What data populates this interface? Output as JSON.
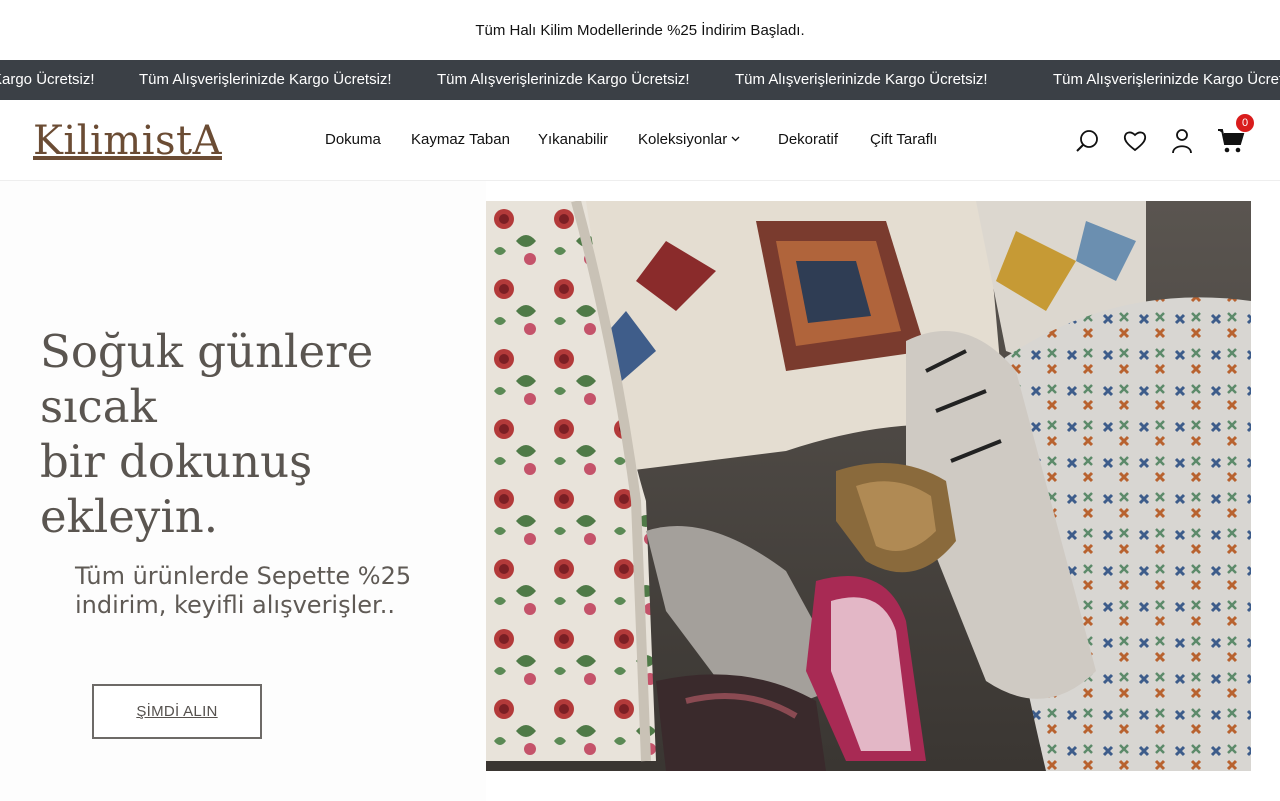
{
  "announcement": {
    "text": "Tüm Halı Kilim Modellerinde %25 İndirim Başladı."
  },
  "marquee": {
    "items": [
      "Kargo Ücretsiz!",
      "Tüm Alışverişlerinizde Kargo Ücretsiz!",
      "Tüm Alışverişlerinizde Kargo Ücretsiz!",
      "Tüm Alışverişlerinizde Kargo Ücretsiz!",
      "Tüm Alışverişlerinizde Kargo Ücretsiz!"
    ]
  },
  "header": {
    "logo": "KilimistA",
    "nav": [
      "Dokuma",
      "Kaymaz Taban",
      "Yıkanabilir",
      "Koleksiyonlar",
      "Dekoratif",
      "Çift Taraflı"
    ],
    "cart_count": "0",
    "icons": [
      "search-icon",
      "heart-icon",
      "user-icon",
      "cart-icon"
    ]
  },
  "hero": {
    "headline_line1": "Soğuk günlere sıcak",
    "headline_line2": "bir dokunuş ekleyin.",
    "subline_line1": "Tüm ürünlerde Sepette %25",
    "subline_line2": "indirim, keyifli alışverişler..",
    "cta": "ŞİMDİ ALIN"
  },
  "colors": {
    "marquee_bg": "#3b4046",
    "logo": "#6b4c34",
    "badge": "#d91c1c",
    "headline": "#5a5550"
  }
}
